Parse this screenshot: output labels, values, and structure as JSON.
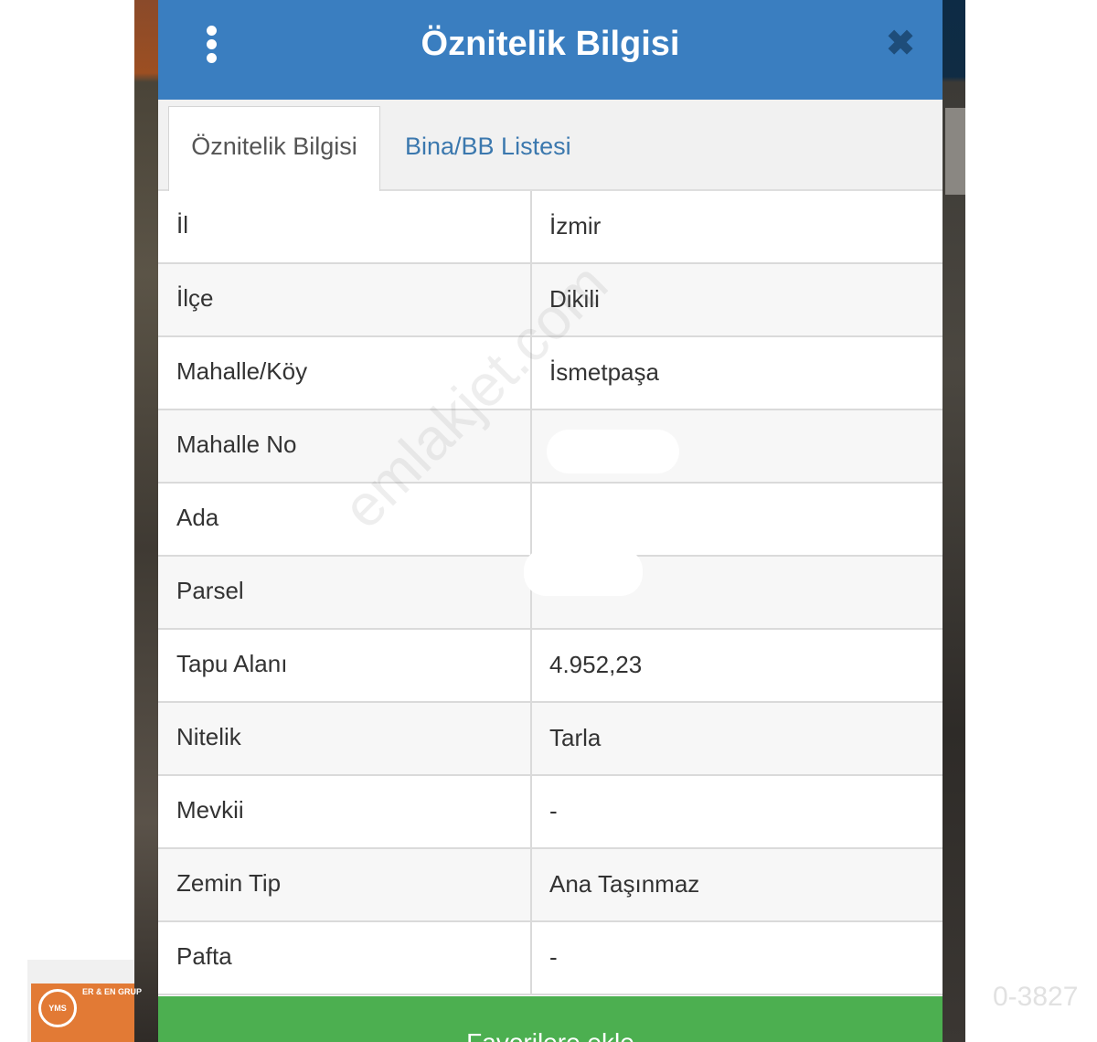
{
  "header": {
    "title": "Öznitelik Bilgisi"
  },
  "tabs": [
    {
      "label": "Öznitelik Bilgisi",
      "active": true
    },
    {
      "label": "Bina/BB Listesi",
      "active": false
    }
  ],
  "rows": [
    {
      "label": "İl",
      "value": "İzmir"
    },
    {
      "label": "İlçe",
      "value": "Dikili"
    },
    {
      "label": "Mahalle/Köy",
      "value": "İsmetpaşa"
    },
    {
      "label": "Mahalle No",
      "value": ""
    },
    {
      "label": "Ada",
      "value": ""
    },
    {
      "label": "Parsel",
      "value": ""
    },
    {
      "label": "Tapu Alanı",
      "value": "4.952,23"
    },
    {
      "label": "Nitelik",
      "value": "Tarla"
    },
    {
      "label": "Mevkii",
      "value": "-"
    },
    {
      "label": "Zemin Tip",
      "value": "Ana Taşınmaz"
    },
    {
      "label": "Pafta",
      "value": "-"
    }
  ],
  "footer": {
    "button_label": "Favorilere ekle"
  },
  "watermark": "emlakjet.com",
  "logo": {
    "badge": "YMS",
    "brand": "ER & EN GRUP"
  },
  "listing_ref": "0-3827",
  "colors": {
    "header": "#3a7ec0",
    "footer": "#4caf50",
    "tab_link": "#3b78ae"
  }
}
